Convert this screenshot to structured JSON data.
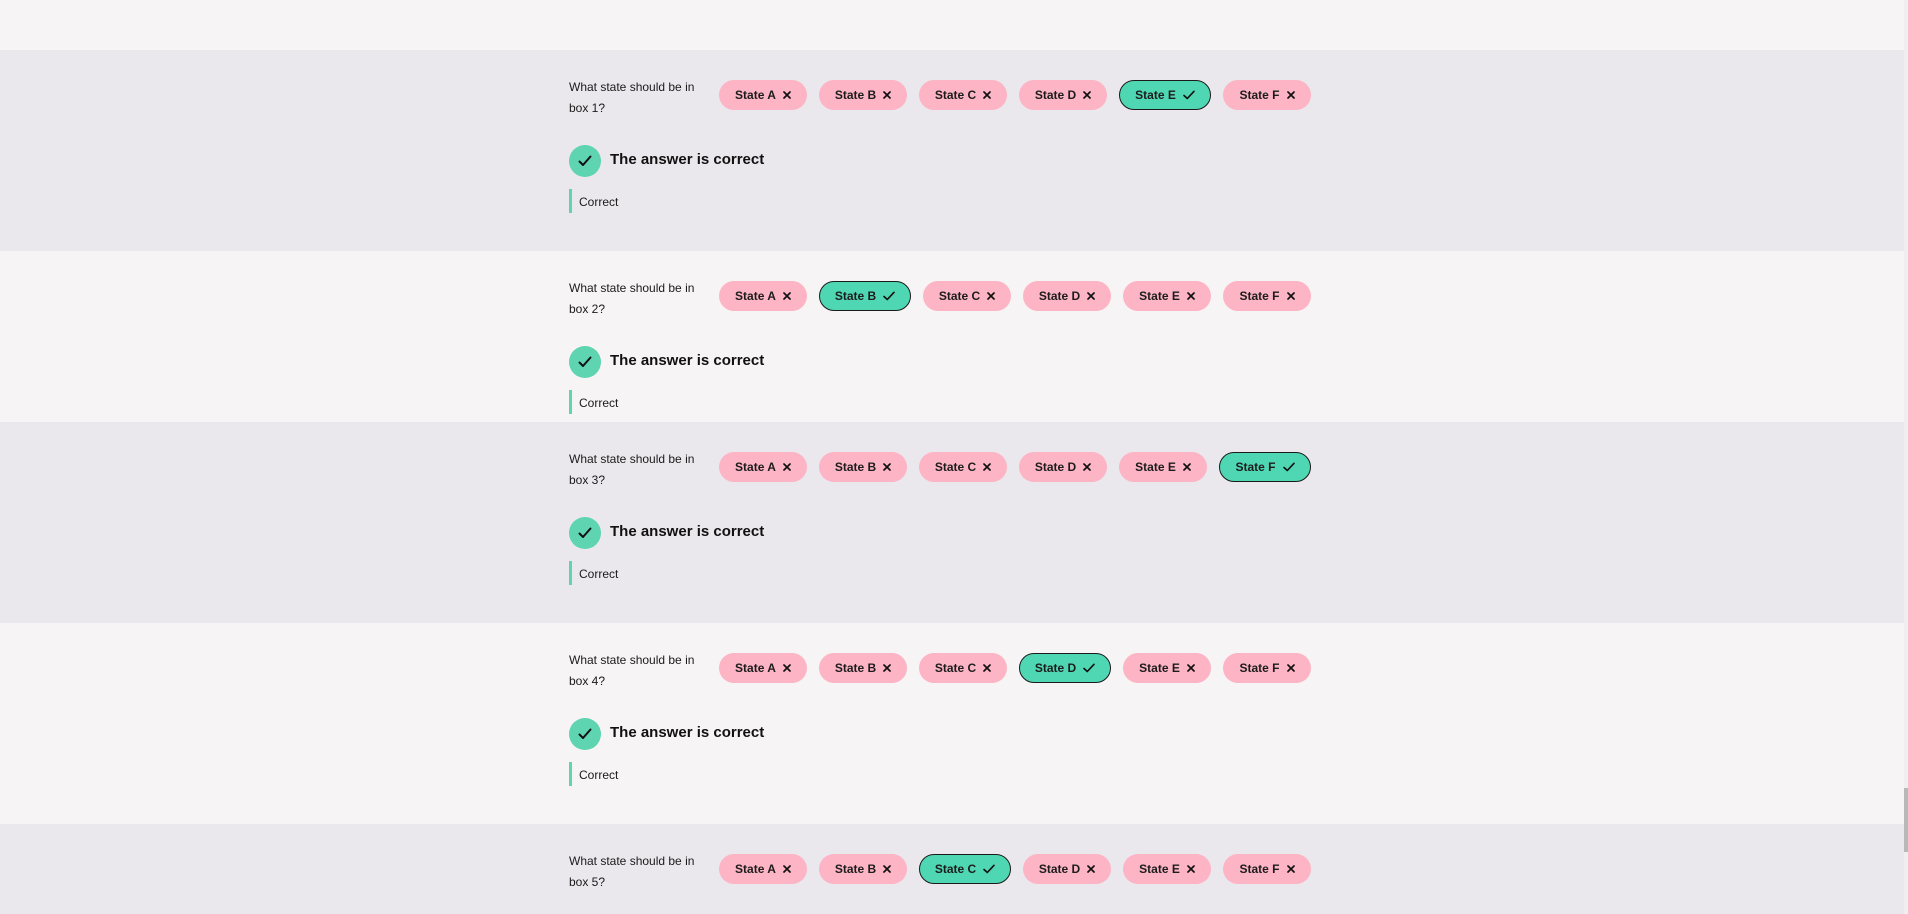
{
  "questions": [
    {
      "text": "What state should be in box 1?",
      "options": [
        {
          "label": "State A",
          "state": "wrong"
        },
        {
          "label": "State B",
          "state": "wrong"
        },
        {
          "label": "State C",
          "state": "wrong"
        },
        {
          "label": "State D",
          "state": "wrong"
        },
        {
          "label": "State E",
          "state": "correct"
        },
        {
          "label": "State F",
          "state": "wrong"
        }
      ],
      "result": "The answer is correct",
      "feedback": "Correct"
    },
    {
      "text": "What state should be in box 2?",
      "options": [
        {
          "label": "State A",
          "state": "wrong"
        },
        {
          "label": "State B",
          "state": "correct"
        },
        {
          "label": "State C",
          "state": "wrong"
        },
        {
          "label": "State D",
          "state": "wrong"
        },
        {
          "label": "State E",
          "state": "wrong"
        },
        {
          "label": "State F",
          "state": "wrong"
        }
      ],
      "result": "The answer is correct",
      "feedback": "Correct"
    },
    {
      "text": "What state should be in box 3?",
      "options": [
        {
          "label": "State A",
          "state": "wrong"
        },
        {
          "label": "State B",
          "state": "wrong"
        },
        {
          "label": "State C",
          "state": "wrong"
        },
        {
          "label": "State D",
          "state": "wrong"
        },
        {
          "label": "State E",
          "state": "wrong"
        },
        {
          "label": "State F",
          "state": "correct"
        }
      ],
      "result": "The answer is correct",
      "feedback": "Correct"
    },
    {
      "text": "What state should be in box 4?",
      "options": [
        {
          "label": "State A",
          "state": "wrong"
        },
        {
          "label": "State B",
          "state": "wrong"
        },
        {
          "label": "State C",
          "state": "wrong"
        },
        {
          "label": "State D",
          "state": "correct"
        },
        {
          "label": "State E",
          "state": "wrong"
        },
        {
          "label": "State F",
          "state": "wrong"
        }
      ],
      "result": "The answer is correct",
      "feedback": "Correct"
    },
    {
      "text": "What state should be in box 5?",
      "options": [
        {
          "label": "State A",
          "state": "wrong"
        },
        {
          "label": "State B",
          "state": "wrong"
        },
        {
          "label": "State C",
          "state": "correct"
        },
        {
          "label": "State D",
          "state": "wrong"
        },
        {
          "label": "State E",
          "state": "wrong"
        },
        {
          "label": "State F",
          "state": "wrong"
        }
      ],
      "result": "",
      "feedback": ""
    }
  ],
  "colors": {
    "wrong_chip": "#fdb4c5",
    "correct_chip": "#4fd6b3",
    "success_accent": "#5fd4b1"
  },
  "icons": {
    "wrong": "close-icon",
    "correct": "check-icon"
  }
}
